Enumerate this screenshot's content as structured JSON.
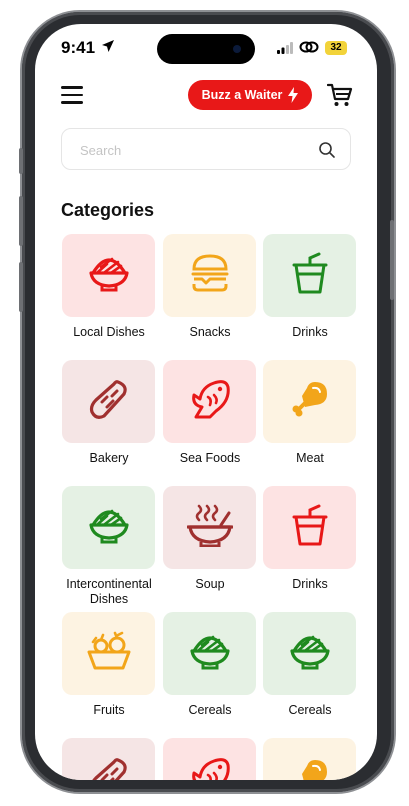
{
  "status_bar": {
    "time": "9:41",
    "battery": "32"
  },
  "header": {
    "buzz_label": "Buzz a Waiter"
  },
  "search": {
    "placeholder": "Search"
  },
  "section_title": "Categories",
  "categories": [
    {
      "label": "Local Dishes",
      "icon": "bowl-icon",
      "bg": "#fde3e3",
      "color": "#e81818"
    },
    {
      "label": "Snacks",
      "icon": "burger-icon",
      "bg": "#fdf3e2",
      "color": "#f2a51a"
    },
    {
      "label": "Drinks",
      "icon": "cup-icon",
      "bg": "#e5f1e4",
      "color": "#1f8a1f"
    },
    {
      "label": "Bakery",
      "icon": "bread-icon",
      "bg": "#f5e5e5",
      "color": "#a0302f"
    },
    {
      "label": "Sea Foods",
      "icon": "fish-icon",
      "bg": "#fde3e3",
      "color": "#e81818"
    },
    {
      "label": "Meat",
      "icon": "drumstick-icon",
      "bg": "#fdf3e2",
      "color": "#f2a51a"
    },
    {
      "label": "Intercontinental Dishes",
      "icon": "bowl-icon",
      "bg": "#e5f1e4",
      "color": "#1f8a1f"
    },
    {
      "label": "Soup",
      "icon": "soup-icon",
      "bg": "#f5e5e5",
      "color": "#a0302f"
    },
    {
      "label": "Drinks",
      "icon": "cup-icon",
      "bg": "#fde3e3",
      "color": "#e81818"
    },
    {
      "label": "Fruits",
      "icon": "fruit-basket-icon",
      "bg": "#fdf3e2",
      "color": "#f2a51a"
    },
    {
      "label": "Cereals",
      "icon": "bowl-icon",
      "bg": "#e5f1e4",
      "color": "#1f8a1f"
    },
    {
      "label": "Cereals",
      "icon": "bowl-icon",
      "bg": "#e5f1e4",
      "color": "#1f8a1f"
    }
  ]
}
